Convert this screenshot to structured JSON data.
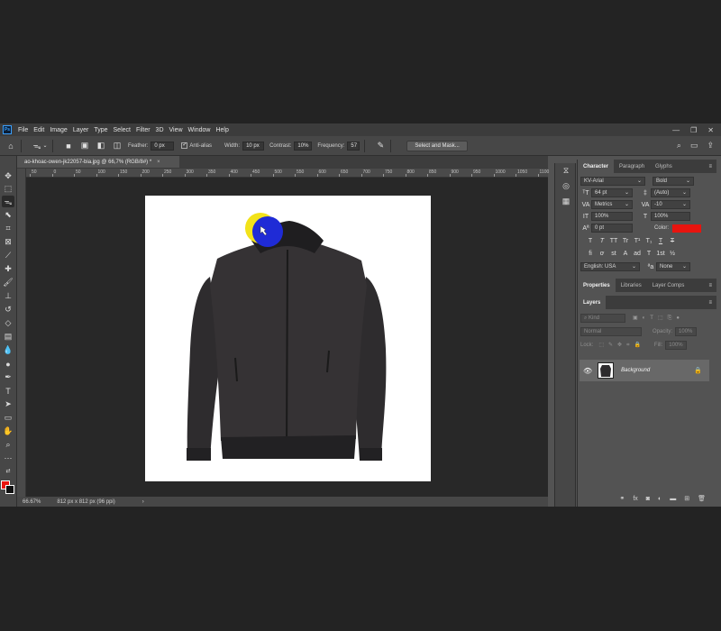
{
  "app": {
    "logo": "Ps",
    "menu": [
      "File",
      "Edit",
      "Image",
      "Layer",
      "Type",
      "Select",
      "Filter",
      "3D",
      "View",
      "Window",
      "Help"
    ],
    "window_controls": [
      "—",
      "❐",
      "✕"
    ]
  },
  "options_bar": {
    "feather_label": "Feather:",
    "feather_value": "0 px",
    "antialias_label": "Anti-alias",
    "width_label": "Width:",
    "width_value": "10 px",
    "contrast_label": "Contrast:",
    "contrast_value": "10%",
    "frequency_label": "Frequency:",
    "frequency_value": "57",
    "select_mask_button": "Select and Mask..."
  },
  "document": {
    "tab_title": "ao-khoac-owen-jk22057-bia.jpg @ 66,7% (RGB/8#) *",
    "tab_close": "×",
    "ruler_ticks": [
      "50",
      "0",
      "50",
      "100",
      "150",
      "200",
      "250",
      "300",
      "350",
      "400",
      "450",
      "500",
      "550",
      "600",
      "650",
      "700",
      "750",
      "800",
      "850",
      "900",
      "950",
      "1000",
      "1050",
      "1100"
    ]
  },
  "status_bar": {
    "zoom": "66.67%",
    "doc_info": "812 px x 812 px (96 ppi)",
    "arrow": "›"
  },
  "character_panel": {
    "tabs": [
      "Character",
      "Paragraph",
      "Glyphs"
    ],
    "font_family": "KV-Arial",
    "font_style": "Bold",
    "font_size": "64 pt",
    "leading": "(Auto)",
    "kerning": "Metrics",
    "tracking": "-10",
    "vertical_scale": "100%",
    "horizontal_scale": "100%",
    "baseline_shift": "0 pt",
    "color_label": "Color:",
    "color_value": "#e8140f",
    "language": "English: USA",
    "antialias_method": "None",
    "format_buttons_1": [
      "T",
      "T",
      "TT",
      "Tr",
      "T¹",
      "T₁",
      "T",
      "T"
    ],
    "format_buttons_2": [
      "fi",
      "ơ",
      "st",
      "A",
      "ad",
      "T",
      "1st",
      "½"
    ]
  },
  "properties_panel": {
    "tabs": [
      "Properties",
      "Libraries",
      "Layer Comps"
    ]
  },
  "layers_panel": {
    "tab": "Layers",
    "filter_placeholder": "Kind",
    "blend_mode": "Normal",
    "opacity_label": "Opacity:",
    "opacity_value": "100%",
    "lock_label": "Lock:",
    "fill_label": "Fill:",
    "fill_value": "100%",
    "layers": [
      {
        "name": "Background",
        "visible": true,
        "locked": true
      }
    ]
  },
  "brush_cursor": {
    "colors": [
      "#f2e21a",
      "#1f2bd6"
    ]
  }
}
